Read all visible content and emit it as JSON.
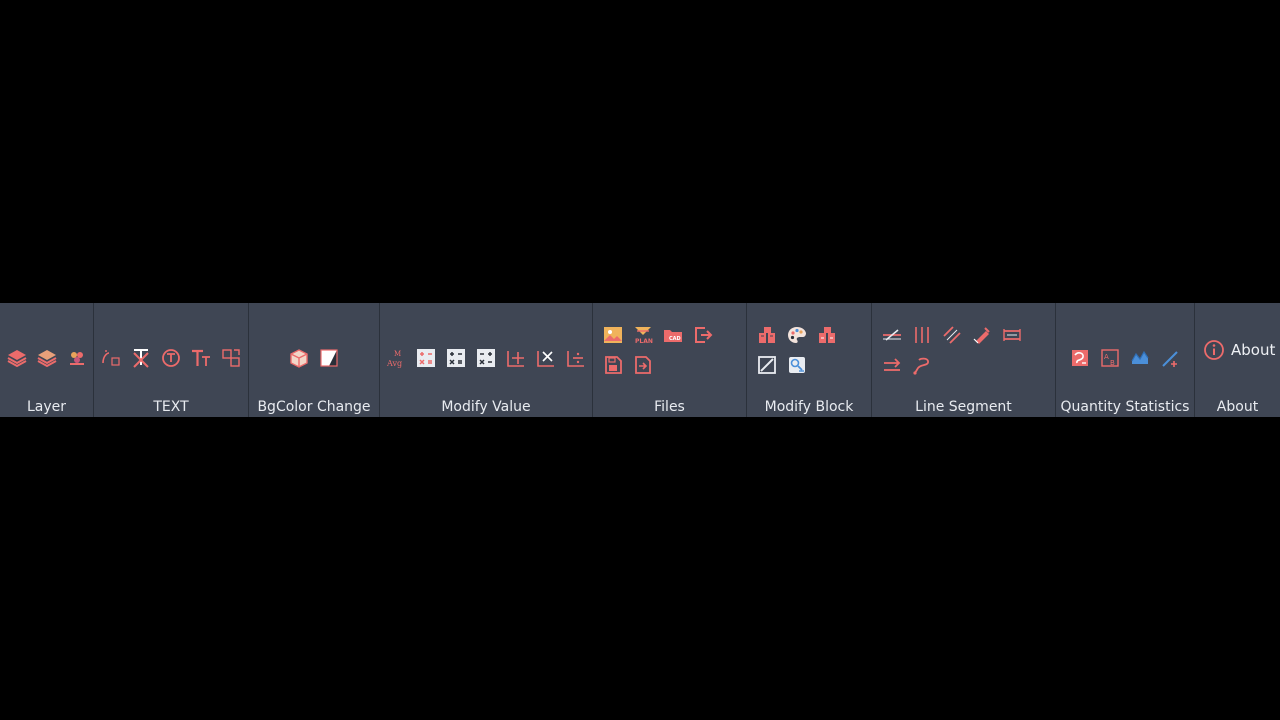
{
  "groups": {
    "layer": {
      "label": "Layer"
    },
    "text": {
      "label": "TEXT"
    },
    "bgcolor": {
      "label": "BgColor Change"
    },
    "modify_value": {
      "label": "Modify Value"
    },
    "files": {
      "label": "Files"
    },
    "modify_block": {
      "label": "Modify Block"
    },
    "line_segment": {
      "label": "Line Segment"
    },
    "quantity": {
      "label": "Quantity Statistics"
    },
    "about": {
      "label": "About",
      "button_label": "About"
    }
  },
  "icons": {
    "layer": [
      "layers-icon",
      "layers-stack-icon",
      "layer-color-icon"
    ],
    "text": [
      "text-ab-icon",
      "text-delete-icon",
      "text-circle-icon",
      "text-size-icon",
      "text-replace-icon"
    ],
    "bgcolor": [
      "cube-icon",
      "contrast-icon"
    ],
    "modify_value": [
      "average-icon",
      "calc-multiply-icon",
      "calc-add-icon",
      "calc-subtract-icon",
      "dim-add-icon",
      "dim-multiply-icon",
      "dim-divide-icon"
    ],
    "files": [
      "image-file-icon",
      "plan-icon",
      "cad-folder-icon",
      "export-icon",
      "save-file-icon",
      "import-file-icon"
    ],
    "modify_block": [
      "block-edit-icon",
      "palette-icon",
      "block-replace-icon",
      "slash-box-icon",
      "block-scale-icon"
    ],
    "line_segment": [
      "line-cut-icon",
      "parallel-lines-icon",
      "diagonal-lines-icon",
      "line-edit-icon",
      "line-extend-icon",
      "arrow-right-icon",
      "polyline-icon"
    ],
    "quantity": [
      "count-block-icon",
      "count-text-icon",
      "count-area-icon",
      "count-length-icon"
    ]
  },
  "colors": {
    "accent": "#ec6b6b",
    "blue_accent": "#4b8fd9",
    "ribbon_bg": "#3f4654",
    "label_text": "#e8ebf0"
  }
}
